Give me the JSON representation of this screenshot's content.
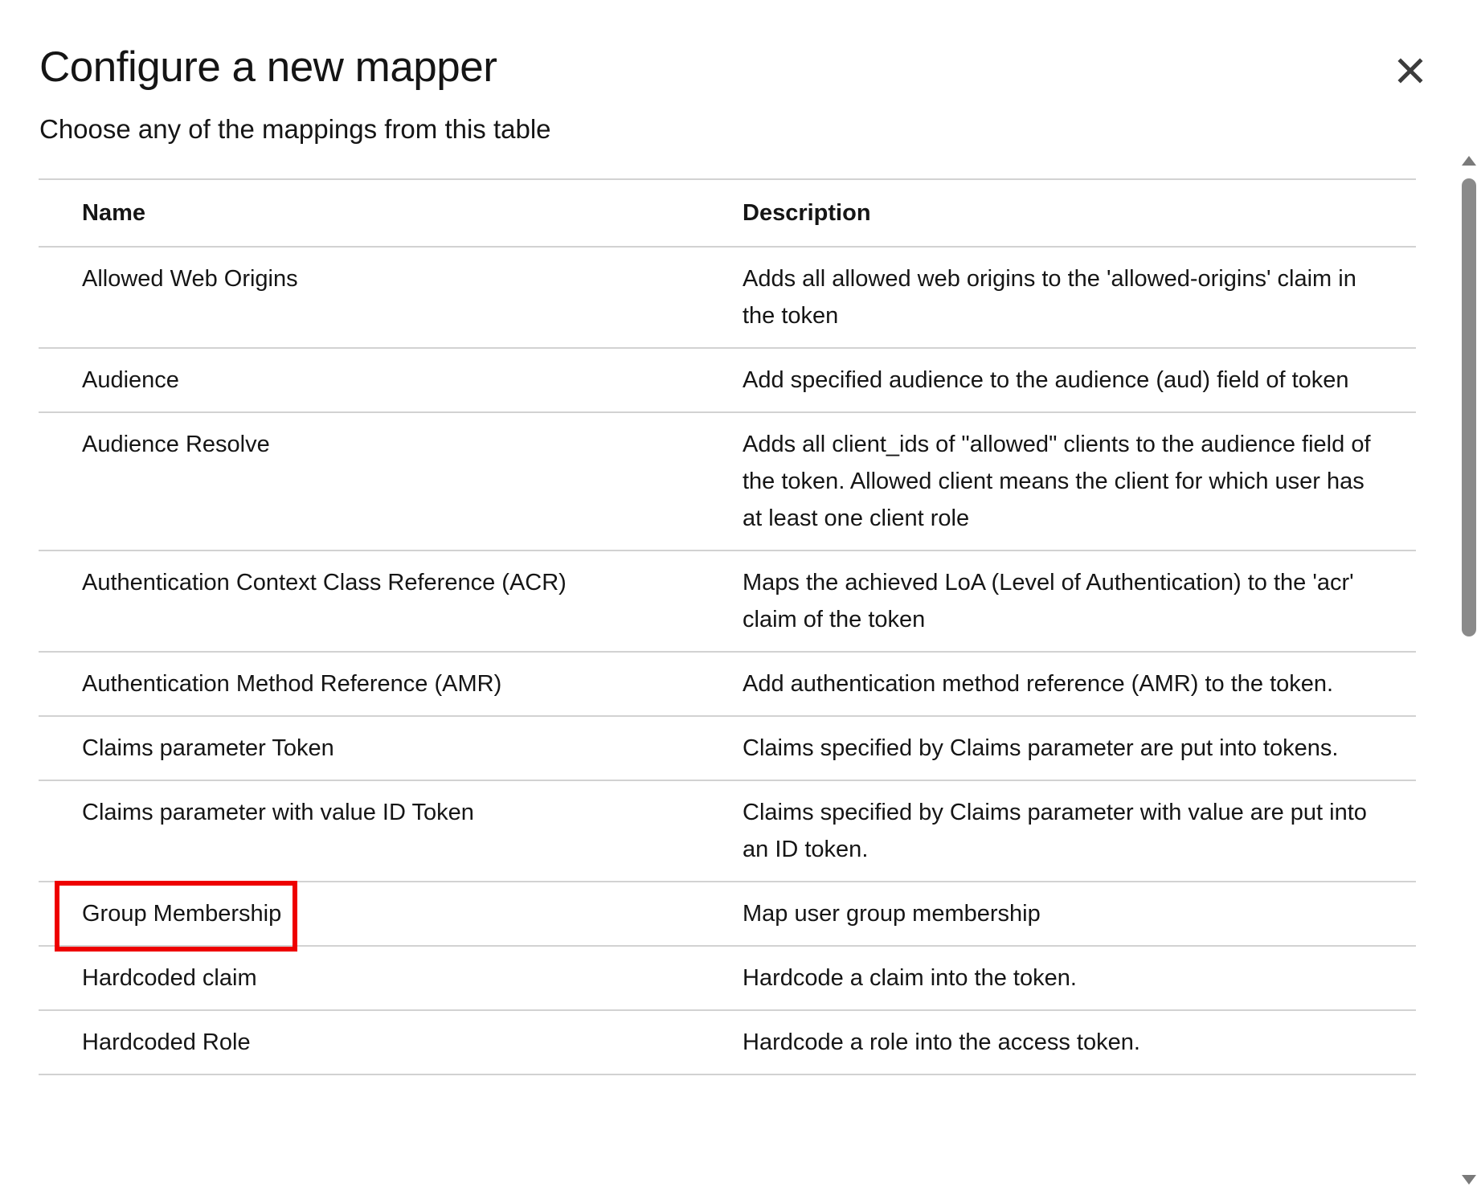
{
  "modal": {
    "title": "Configure a new mapper",
    "subtitle": "Choose any of the mappings from this table",
    "close_icon": "close-icon"
  },
  "table": {
    "columns": [
      "Name",
      "Description"
    ],
    "rows": [
      {
        "name": "Allowed Web Origins",
        "description": "Adds all allowed web origins to the 'allowed-origins' claim in the token"
      },
      {
        "name": "Audience",
        "description": "Add specified audience to the audience (aud) field of token"
      },
      {
        "name": "Audience Resolve",
        "description": "Adds all client_ids of \"allowed\" clients to the audience field of the token. Allowed client means the client for which user has at least one client role"
      },
      {
        "name": "Authentication Context Class Reference (ACR)",
        "description": "Maps the achieved LoA (Level of Authentication) to the 'acr' claim of the token"
      },
      {
        "name": "Authentication Method Reference (AMR)",
        "description": "Add authentication method reference (AMR) to the token."
      },
      {
        "name": "Claims parameter Token",
        "description": "Claims specified by Claims parameter are put into tokens."
      },
      {
        "name": "Claims parameter with value ID Token",
        "description": "Claims specified by Claims parameter with value are put into an ID token."
      },
      {
        "name": "Group Membership",
        "description": "Map user group membership"
      },
      {
        "name": "Hardcoded claim",
        "description": "Hardcode a claim into the token."
      },
      {
        "name": "Hardcoded Role",
        "description": "Hardcode a role into the access token."
      }
    ]
  },
  "highlight": {
    "row_index": 7,
    "color": "#ee0000"
  }
}
